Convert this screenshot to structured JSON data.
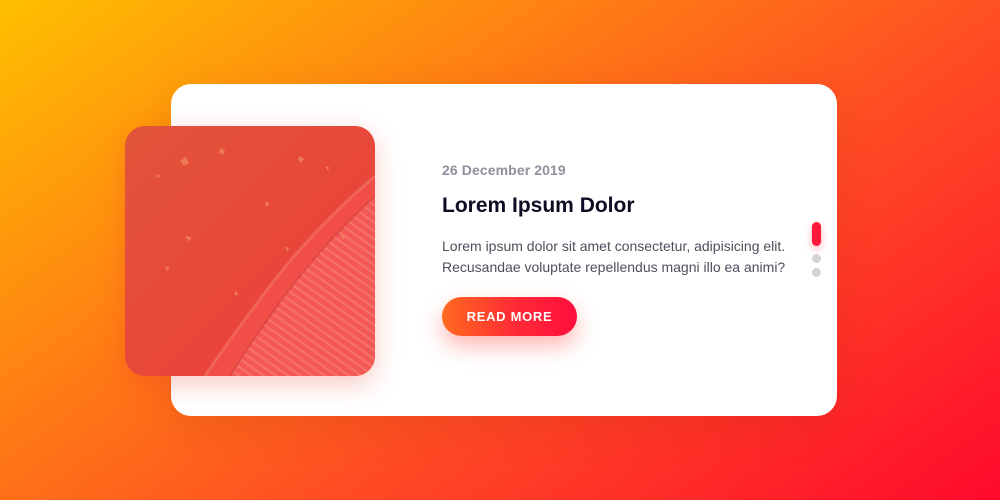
{
  "post": {
    "date": "26 December 2019",
    "title": "Lorem Ipsum Dolor",
    "text": "Lorem ipsum dolor sit amet consectetur, adipisicing elit. Recusandae voluptate repellendus magni illo ea animi?",
    "button_label": "READ MORE",
    "image_icon": "autumn-street-photo"
  },
  "pagination": {
    "total": 3,
    "active_index": 0
  },
  "colors": {
    "accent": "#ff1a3a",
    "title": "#0d0c22",
    "date": "#8f8f9d",
    "text": "#4e4e5c",
    "background_start": "#ffc000",
    "background_end": "#ff0a2c"
  }
}
